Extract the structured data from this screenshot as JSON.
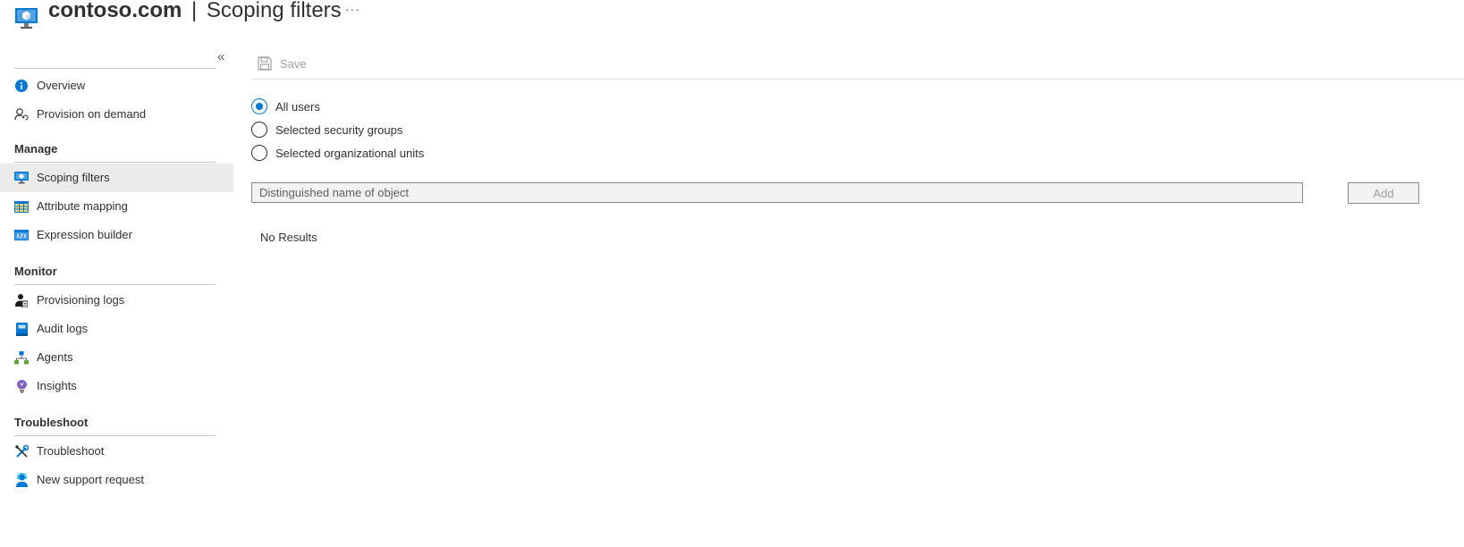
{
  "header": {
    "title_main": "contoso.com",
    "title_separator": "|",
    "title_sub": "Scoping filters",
    "more_label": "···",
    "resource_icon": "virtual-machine-icon"
  },
  "sidebar": {
    "collapse_label": "«",
    "items": [
      {
        "label": "Overview",
        "icon": "info-icon"
      },
      {
        "label": "Provision on demand",
        "icon": "person-sync-icon"
      }
    ],
    "sections": [
      {
        "title": "Manage",
        "items": [
          {
            "label": "Scoping filters",
            "icon": "monitor-icon",
            "active": true
          },
          {
            "label": "Attribute mapping",
            "icon": "table-icon"
          },
          {
            "label": "Expression builder",
            "icon": "code-window-icon"
          }
        ]
      },
      {
        "title": "Monitor",
        "items": [
          {
            "label": "Provisioning logs",
            "icon": "person-log-icon"
          },
          {
            "label": "Audit logs",
            "icon": "book-icon"
          },
          {
            "label": "Agents",
            "icon": "network-icon"
          },
          {
            "label": "Insights",
            "icon": "lightbulb-icon"
          }
        ]
      },
      {
        "title": "Troubleshoot",
        "items": [
          {
            "label": "Troubleshoot",
            "icon": "wrench-icon"
          },
          {
            "label": "New support request",
            "icon": "support-person-icon"
          }
        ]
      }
    ]
  },
  "toolbar": {
    "save_label": "Save",
    "save_enabled": false
  },
  "scope": {
    "options": [
      {
        "label": "All users",
        "checked": true
      },
      {
        "label": "Selected security groups",
        "checked": false
      },
      {
        "label": "Selected organizational units",
        "checked": false
      }
    ],
    "dn_input": {
      "placeholder": "Distinguished name of object",
      "value": ""
    },
    "add_label": "Add",
    "no_results": "No Results"
  },
  "colors": {
    "accent": "#0078d4",
    "active_nav_bg": "#edebe9",
    "disabled_text": "#a19f9d"
  }
}
